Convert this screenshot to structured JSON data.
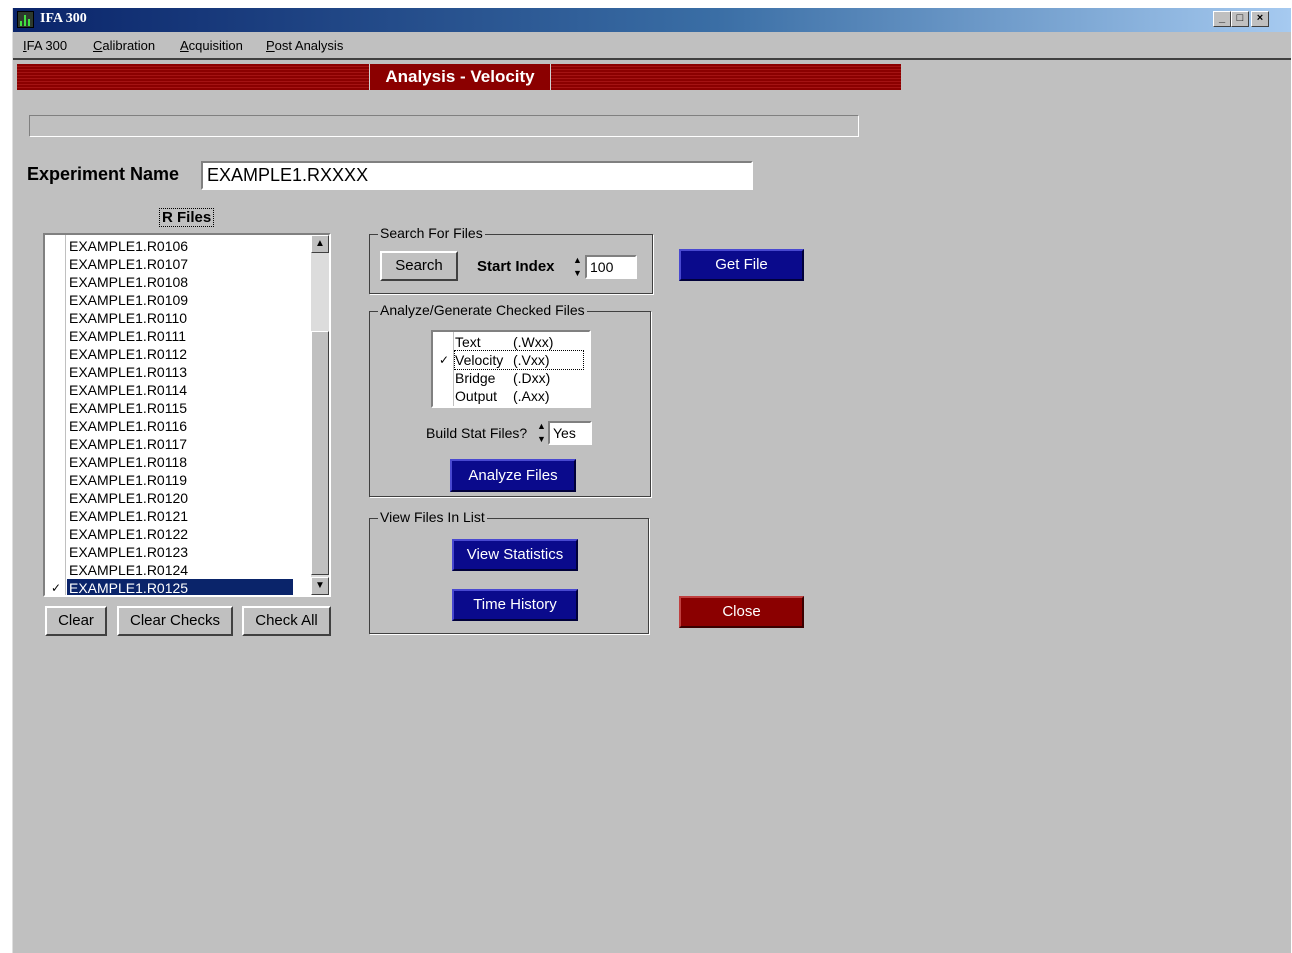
{
  "window": {
    "title": "IFA 300",
    "controls": [
      "_",
      "□",
      "×"
    ]
  },
  "menu": [
    {
      "accel": "I",
      "rest": "FA 300"
    },
    {
      "accel": "C",
      "rest": "alibration"
    },
    {
      "accel": "A",
      "rest": "cquisition"
    },
    {
      "accel": "P",
      "rest": "ost Analysis"
    }
  ],
  "header": {
    "title": "Analysis - Velocity"
  },
  "experiment": {
    "label": "Experiment Name",
    "value": "EXAMPLE1.RXXXX"
  },
  "rfiles": {
    "label": "R Files",
    "items": [
      {
        "name": "EXAMPLE1.R0106",
        "checked": ""
      },
      {
        "name": "EXAMPLE1.R0107",
        "checked": ""
      },
      {
        "name": "EXAMPLE1.R0108",
        "checked": ""
      },
      {
        "name": "EXAMPLE1.R0109",
        "checked": ""
      },
      {
        "name": "EXAMPLE1.R0110",
        "checked": ""
      },
      {
        "name": "EXAMPLE1.R0111",
        "checked": ""
      },
      {
        "name": "EXAMPLE1.R0112",
        "checked": ""
      },
      {
        "name": "EXAMPLE1.R0113",
        "checked": ""
      },
      {
        "name": "EXAMPLE1.R0114",
        "checked": ""
      },
      {
        "name": "EXAMPLE1.R0115",
        "checked": ""
      },
      {
        "name": "EXAMPLE1.R0116",
        "checked": ""
      },
      {
        "name": "EXAMPLE1.R0117",
        "checked": ""
      },
      {
        "name": "EXAMPLE1.R0118",
        "checked": ""
      },
      {
        "name": "EXAMPLE1.R0119",
        "checked": ""
      },
      {
        "name": "EXAMPLE1.R0120",
        "checked": ""
      },
      {
        "name": "EXAMPLE1.R0121",
        "checked": ""
      },
      {
        "name": "EXAMPLE1.R0122",
        "checked": ""
      },
      {
        "name": "EXAMPLE1.R0123",
        "checked": ""
      },
      {
        "name": "EXAMPLE1.R0124",
        "checked": ""
      },
      {
        "name": "EXAMPLE1.R0125",
        "checked": "✓"
      }
    ],
    "selected_index": 19,
    "buttons": {
      "clear": "Clear",
      "clear_checks": "Clear Checks",
      "check_all": "Check All"
    }
  },
  "search": {
    "group_title": "Search For Files",
    "search_button": "Search",
    "start_index_label": "Start Index",
    "start_index_value": "100"
  },
  "get_file_button": "Get File",
  "analyze": {
    "group_title": "Analyze/Generate Checked Files",
    "types": [
      {
        "name": "Text",
        "ext": "(.Wxx)",
        "checked": ""
      },
      {
        "name": "Velocity",
        "ext": "(.Vxx)",
        "checked": "✓"
      },
      {
        "name": "Bridge",
        "ext": "(.Dxx)",
        "checked": ""
      },
      {
        "name": "Output",
        "ext": "(.Axx)",
        "checked": ""
      }
    ],
    "build_stat_label": "Build Stat Files?",
    "build_stat_value": "Yes",
    "analyze_button": "Analyze Files"
  },
  "view": {
    "group_title": "View Files In List",
    "statistics_button": "View Statistics",
    "time_history_button": "Time History"
  },
  "close_button": "Close"
}
